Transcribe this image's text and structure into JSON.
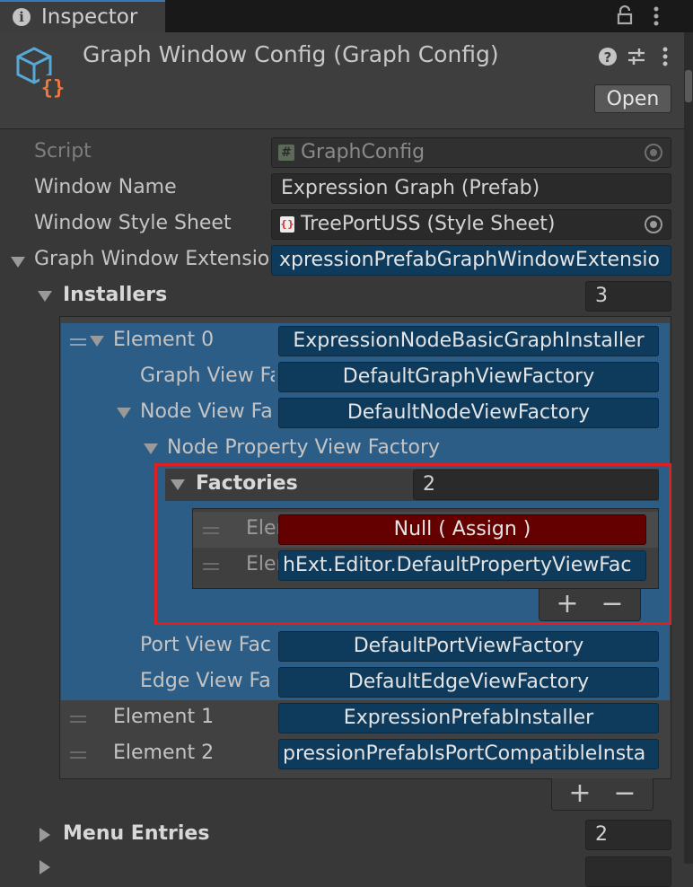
{
  "tab": {
    "label": "Inspector"
  },
  "header": {
    "title": "Graph Window Config (Graph Config)",
    "open_button": "Open"
  },
  "fields": {
    "script": {
      "label": "Script",
      "value": "GraphConfig"
    },
    "window_name": {
      "label": "Window Name",
      "value": "Expression Graph (Prefab)"
    },
    "window_style_sheet": {
      "label": "Window Style Sheet",
      "value": "TreePortUSS (Style Sheet)"
    },
    "graph_window_extension": {
      "label": "Graph Window Extensio",
      "value": "xpressionPrefabGraphWindowExtensio"
    }
  },
  "installers": {
    "label": "Installers",
    "count": "3",
    "element0": {
      "label": "Element 0",
      "value": "ExpressionNodeBasicGraphInstaller",
      "graph_view_factory": {
        "label": "Graph View Fa",
        "value": "DefaultGraphViewFactory"
      },
      "node_view_factory": {
        "label": "Node View Fa",
        "value": "DefaultNodeViewFactory"
      },
      "node_property_view_factory": {
        "label": "Node Property View Factory"
      },
      "factories": {
        "label": "Factories",
        "count": "2",
        "item0": {
          "label": "Eler",
          "value": "Null ( Assign )"
        },
        "item1": {
          "label": "Eler",
          "value": "hExt.Editor.DefaultPropertyViewFac"
        }
      },
      "port_view_factory": {
        "label": "Port View Fac",
        "value": "DefaultPortViewFactory"
      },
      "edge_view_factory": {
        "label": "Edge View Fa",
        "value": "DefaultEdgeViewFactory"
      }
    },
    "element1": {
      "label": "Element 1",
      "value": "ExpressionPrefabInstaller"
    },
    "element2": {
      "label": "Element 2",
      "value": "pressionPrefabIsPortCompatibleInsta"
    }
  },
  "list_controls": {
    "add": "+",
    "remove": "−"
  },
  "menu_entries": {
    "label": "Menu Entries",
    "count": "2"
  },
  "colors": {
    "highlight": "#e02020",
    "selection": "#2c5d87",
    "null_field": "#650000"
  }
}
